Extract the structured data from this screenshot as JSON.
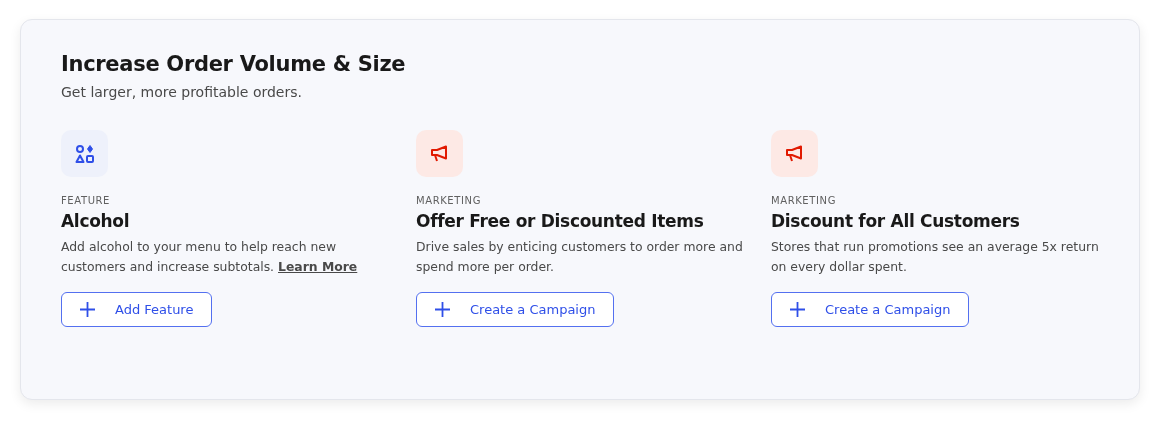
{
  "section": {
    "title": "Increase Order Volume & Size",
    "subtitle": "Get larger, more profitable orders."
  },
  "cards": [
    {
      "kind": "feature",
      "category": "FEATURE",
      "title": "Alcohol",
      "description": "Add alcohol to your menu to help reach new customers and increase subtotals.",
      "link": "Learn More",
      "button": "Add Feature"
    },
    {
      "kind": "marketing",
      "category": "MARKETING",
      "title": "Offer Free or Discounted Items",
      "description": "Drive sales by enticing customers to order more and spend more per order.",
      "button": "Create a Campaign"
    },
    {
      "kind": "marketing",
      "category": "MARKETING",
      "title": "Discount for All Customers",
      "description": "Stores that run promotions see an average 5x return on every dollar spent.",
      "button": "Create a Campaign"
    }
  ]
}
